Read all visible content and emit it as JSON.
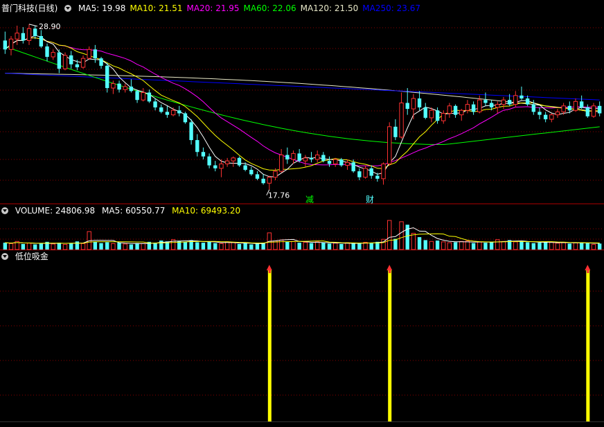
{
  "header": {
    "stock_name": "普门科技(日线)",
    "ma_labels": [
      {
        "name": "MA5",
        "value": "19.98",
        "color": "#ffffff"
      },
      {
        "name": "MA10",
        "value": "21.51",
        "color": "#ffff00"
      },
      {
        "name": "MA20",
        "value": "21.95",
        "color": "#ff00ff"
      },
      {
        "name": "MA60",
        "value": "22.06",
        "color": "#00ff00"
      },
      {
        "name": "MA120",
        "value": "21.50",
        "color": "#e8e8c8"
      },
      {
        "name": "MA250",
        "value": "23.67",
        "color": "#0000ff"
      }
    ]
  },
  "volume_header": {
    "label": "VOLUME: 24806.98",
    "ma5": "MA5: 60550.77",
    "ma10": "MA10: 69493.20"
  },
  "indicator_header": {
    "label": "低位吸金"
  },
  "annotations": {
    "high_label": "28.90",
    "low_label": "17.76",
    "marker_1": "减",
    "marker_2": "财"
  },
  "colors": {
    "up": "#ff3232",
    "down": "#54ffff",
    "grid": "#8b0000",
    "signal": "#ffff00"
  },
  "chart_data": {
    "type": "candlestick",
    "price_range": [
      17.0,
      29.5
    ],
    "high": 28.9,
    "low": 17.76,
    "candles": [
      [
        27.8,
        28.4,
        26.9,
        27.2
      ],
      [
        27.2,
        28.1,
        26.8,
        27.9
      ],
      [
        27.9,
        28.8,
        27.5,
        28.3
      ],
      [
        28.3,
        28.7,
        27.6,
        27.8
      ],
      [
        27.8,
        28.9,
        27.5,
        28.6
      ],
      [
        28.6,
        28.8,
        27.9,
        28.1
      ],
      [
        28.1,
        28.5,
        27.3,
        27.4
      ],
      [
        27.4,
        27.6,
        26.4,
        26.7
      ],
      [
        26.7,
        27.2,
        26.5,
        27.0
      ],
      [
        27.0,
        27.2,
        25.6,
        25.9
      ],
      [
        25.9,
        27.0,
        25.8,
        26.8
      ],
      [
        26.8,
        27.1,
        25.9,
        26.2
      ],
      [
        26.2,
        26.5,
        25.8,
        26.0
      ],
      [
        26.0,
        26.8,
        25.9,
        26.6
      ],
      [
        26.6,
        27.4,
        26.5,
        27.2
      ],
      [
        27.2,
        27.5,
        26.3,
        26.6
      ],
      [
        26.6,
        26.7,
        25.9,
        26.1
      ],
      [
        26.1,
        26.3,
        24.3,
        24.6
      ],
      [
        24.6,
        25.1,
        24.2,
        24.9
      ],
      [
        24.9,
        25.1,
        24.3,
        24.5
      ],
      [
        24.5,
        24.9,
        24.3,
        24.7
      ],
      [
        24.7,
        25.2,
        24.3,
        24.4
      ],
      [
        24.4,
        24.5,
        23.6,
        23.8
      ],
      [
        23.8,
        24.6,
        23.7,
        24.3
      ],
      [
        24.3,
        24.5,
        23.6,
        23.7
      ],
      [
        23.7,
        23.9,
        23.1,
        23.3
      ],
      [
        23.3,
        23.5,
        22.9,
        23.0
      ],
      [
        23.0,
        23.4,
        22.6,
        22.8
      ],
      [
        22.8,
        23.3,
        22.7,
        23.1
      ],
      [
        23.1,
        23.4,
        22.7,
        22.9
      ],
      [
        22.9,
        23.0,
        22.2,
        22.3
      ],
      [
        22.3,
        22.5,
        20.8,
        21.1
      ],
      [
        21.1,
        21.5,
        20.0,
        20.3
      ],
      [
        20.3,
        20.6,
        19.8,
        20.0
      ],
      [
        20.0,
        20.2,
        19.2,
        19.4
      ],
      [
        19.4,
        19.7,
        19.0,
        19.2
      ],
      [
        19.2,
        19.8,
        18.6,
        19.5
      ],
      [
        19.5,
        19.9,
        19.3,
        19.7
      ],
      [
        19.7,
        20.0,
        19.3,
        19.9
      ],
      [
        19.9,
        20.0,
        19.3,
        19.4
      ],
      [
        19.4,
        19.6,
        19.0,
        19.1
      ],
      [
        19.1,
        19.3,
        18.7,
        18.8
      ],
      [
        18.8,
        19.0,
        18.4,
        18.5
      ],
      [
        18.5,
        18.8,
        18.1,
        18.2
      ],
      [
        18.2,
        18.7,
        17.76,
        18.6
      ],
      [
        18.6,
        19.2,
        18.4,
        19.0
      ],
      [
        19.0,
        20.5,
        18.9,
        20.1
      ],
      [
        20.1,
        20.6,
        19.5,
        19.8
      ],
      [
        19.8,
        20.4,
        19.5,
        20.2
      ],
      [
        20.2,
        20.5,
        19.6,
        19.7
      ],
      [
        19.7,
        20.1,
        19.3,
        19.9
      ],
      [
        19.9,
        20.3,
        19.6,
        19.8
      ],
      [
        19.8,
        20.4,
        19.6,
        20.1
      ],
      [
        20.1,
        20.3,
        19.6,
        19.7
      ],
      [
        19.7,
        20.0,
        19.3,
        19.5
      ],
      [
        19.5,
        19.9,
        19.3,
        19.8
      ],
      [
        19.8,
        19.9,
        19.3,
        19.4
      ],
      [
        19.4,
        19.8,
        19.1,
        19.6
      ],
      [
        19.6,
        19.8,
        18.9,
        19.0
      ],
      [
        19.0,
        19.2,
        18.4,
        18.6
      ],
      [
        18.6,
        19.4,
        18.5,
        19.2
      ],
      [
        19.2,
        19.4,
        18.5,
        18.7
      ],
      [
        18.7,
        18.9,
        18.3,
        18.5
      ],
      [
        18.5,
        19.6,
        18.1,
        19.5
      ],
      [
        19.5,
        22.3,
        19.4,
        22.0
      ],
      [
        22.0,
        22.5,
        21.1,
        21.3
      ],
      [
        21.3,
        24.3,
        21.2,
        23.6
      ],
      [
        23.6,
        24.6,
        22.8,
        23.2
      ],
      [
        23.2,
        24.2,
        22.5,
        23.9
      ],
      [
        23.9,
        24.4,
        23.1,
        23.3
      ],
      [
        23.3,
        23.6,
        22.5,
        22.6
      ],
      [
        22.6,
        23.3,
        22.3,
        23.1
      ],
      [
        23.1,
        23.3,
        22.2,
        22.4
      ],
      [
        22.4,
        23.1,
        22.2,
        22.9
      ],
      [
        22.9,
        23.6,
        22.6,
        23.4
      ],
      [
        23.4,
        23.5,
        22.6,
        22.8
      ],
      [
        22.8,
        23.2,
        22.4,
        23.1
      ],
      [
        23.1,
        23.8,
        22.9,
        23.5
      ],
      [
        23.5,
        23.7,
        22.8,
        23.0
      ],
      [
        23.0,
        24.1,
        22.9,
        23.8
      ],
      [
        23.8,
        24.3,
        23.4,
        23.6
      ],
      [
        23.6,
        23.8,
        23.1,
        23.3
      ],
      [
        23.3,
        23.7,
        22.9,
        23.5
      ],
      [
        23.5,
        24.0,
        23.2,
        23.8
      ],
      [
        23.8,
        24.2,
        23.4,
        23.5
      ],
      [
        23.5,
        24.4,
        23.3,
        24.1
      ],
      [
        24.1,
        24.7,
        23.8,
        23.9
      ],
      [
        23.9,
        24.1,
        23.4,
        23.5
      ],
      [
        23.5,
        23.8,
        22.8,
        23.0
      ],
      [
        23.0,
        23.3,
        22.5,
        22.8
      ],
      [
        22.8,
        23.0,
        22.3,
        22.5
      ],
      [
        22.5,
        22.9,
        22.3,
        22.8
      ],
      [
        22.8,
        23.2,
        22.6,
        23.0
      ],
      [
        23.0,
        23.6,
        22.8,
        23.4
      ],
      [
        23.4,
        23.7,
        22.9,
        23.1
      ],
      [
        23.1,
        23.9,
        23.0,
        23.7
      ],
      [
        23.7,
        24.1,
        23.2,
        23.3
      ],
      [
        23.3,
        23.5,
        22.6,
        22.7
      ],
      [
        22.7,
        23.6,
        22.6,
        23.4
      ],
      [
        23.4,
        23.7,
        22.7,
        22.9
      ]
    ],
    "volume": [
      1.6,
      1.4,
      1.9,
      1.3,
      1.5,
      1.2,
      1.4,
      1.8,
      1.3,
      1.6,
      1.2,
      1.5,
      1.9,
      1.4,
      4.2,
      1.8,
      1.5,
      1.7,
      1.4,
      1.6,
      1.3,
      1.2,
      1.5,
      1.4,
      1.8,
      1.6,
      2.1,
      1.9,
      2.3,
      2.0,
      1.8,
      2.2,
      1.7,
      1.6,
      1.9,
      1.5,
      1.4,
      1.8,
      1.6,
      1.3,
      1.5,
      1.2,
      1.4,
      1.6,
      3.9,
      2.0,
      2.2,
      1.8,
      1.9,
      1.6,
      1.7,
      1.5,
      1.8,
      1.6,
      1.4,
      1.5,
      1.3,
      1.6,
      1.5,
      1.4,
      1.7,
      1.6,
      1.8,
      2.4,
      6.8,
      2.5,
      6.5,
      5.8,
      3.8,
      2.9,
      2.2,
      1.9,
      2.1,
      1.8,
      1.6,
      1.7,
      1.9,
      2.0,
      1.5,
      1.8,
      1.6,
      1.7,
      2.3,
      1.9,
      2.2,
      1.8,
      1.9,
      1.7,
      1.5,
      1.6,
      1.8,
      1.7,
      1.5,
      1.6,
      1.4,
      1.6,
      1.7,
      1.5,
      1.2,
      1.4
    ],
    "signals": [
      44,
      64,
      97
    ]
  }
}
